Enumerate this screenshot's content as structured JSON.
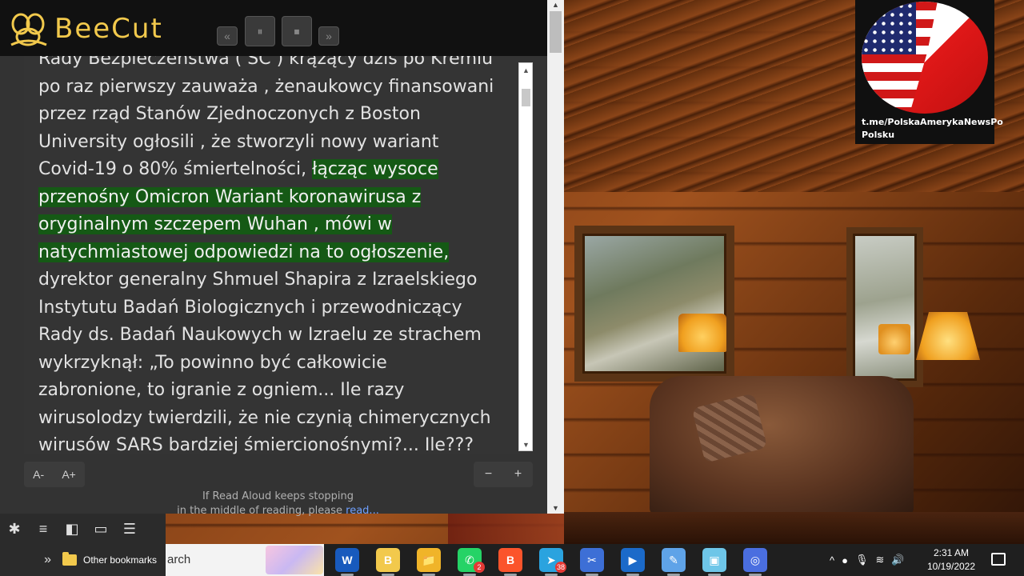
{
  "app": {
    "name": "BeeCut",
    "media_controls": {
      "rewind": "«",
      "pause": "⏸",
      "stop": "⏹",
      "forward": "»"
    }
  },
  "reader": {
    "lines": [
      {
        "text": "Rady Bezpieczeństwa ( SC ) krążący dziś po Kremlu",
        "hl": ""
      },
      {
        "text": "po raz pierwszy zauważa , żenaukowcy finansowani",
        "hl": ""
      },
      {
        "text": "przez rząd Stanów Zjednoczonych z Boston",
        "hl": ""
      },
      {
        "text": "University ogłosili , że stworzyli nowy wariant",
        "hl": ""
      },
      {
        "text": "Covid-19 o 80% śmiertelności, ",
        "hl": "łącząc wysoce"
      },
      {
        "text": "",
        "hl": "przenośny Omicron Wariant koronawirusa z"
      },
      {
        "text": "",
        "hl": "oryginalnym szczepem Wuhan , mówi w"
      },
      {
        "text": "",
        "hl": "natychmiastowej odpowiedzi na to ogłoszenie,"
      },
      {
        "text": "dyrektor generalny Shmuel Shapira z Izraelskiego",
        "hl": ""
      },
      {
        "text": "Instytutu Badań Biologicznych i przewodniczący",
        "hl": ""
      },
      {
        "text": "Rady ds. Badań Naukowych w Izraelu ze strachem",
        "hl": ""
      },
      {
        "text": "wykrzyknął: „To powinno być całkowicie",
        "hl": ""
      },
      {
        "text": "zabronione, to igranie z ogniem... Ile razy",
        "hl": ""
      },
      {
        "text": "wirusolodzy twierdzili, że nie czynią chimerycznych",
        "hl": ""
      },
      {
        "text": "wirusów SARS bardziej śmiercionośnymi?... Ile???",
        "hl": ""
      }
    ],
    "font_decrease": "A-",
    "font_increase": "A+",
    "zoom_out": "−",
    "zoom_in": "+",
    "notice_line1": "If Read Aloud keeps stopping",
    "notice_line2_prefix": "in the middle of reading, please ",
    "notice_link": "read..."
  },
  "flag_badge": {
    "caption_line1": "t.me/PolskaAmerykaNewsPo",
    "caption_line2": "Polsku"
  },
  "browser": {
    "toolbar_icons": [
      "extensions-icon",
      "reading-list-icon",
      "sidebar-icon",
      "wallet-icon",
      "menu-icon"
    ],
    "bookmarks_chevron": "»",
    "bookmarks_folder": "Other bookmarks"
  },
  "taskbar": {
    "search_text": "arch",
    "apps": [
      {
        "name": "word-app",
        "label": "W",
        "color": "#185abd"
      },
      {
        "name": "beecut-app",
        "label": "B",
        "color": "#f2c94c"
      },
      {
        "name": "file-explorer-app",
        "label": "📁",
        "color": "#f0b429"
      },
      {
        "name": "whatsapp-app",
        "label": "✆",
        "color": "#25d366",
        "badge": "2"
      },
      {
        "name": "brave-app",
        "label": "B",
        "color": "#fb542b"
      },
      {
        "name": "telegram-app",
        "label": "➤",
        "color": "#2aa3df",
        "badge": "38"
      },
      {
        "name": "snip-app",
        "label": "✂",
        "color": "#3d6fd6"
      },
      {
        "name": "media-app",
        "label": "▶",
        "color": "#1b6ac9"
      },
      {
        "name": "notepad-app",
        "label": "✎",
        "color": "#5fa3e8"
      },
      {
        "name": "paint-app",
        "label": "▣",
        "color": "#6ec6e8"
      },
      {
        "name": "chrome-app",
        "label": "◎",
        "color": "#4a6ee0"
      }
    ],
    "time": "2:31 AM",
    "date": "10/19/2022"
  }
}
